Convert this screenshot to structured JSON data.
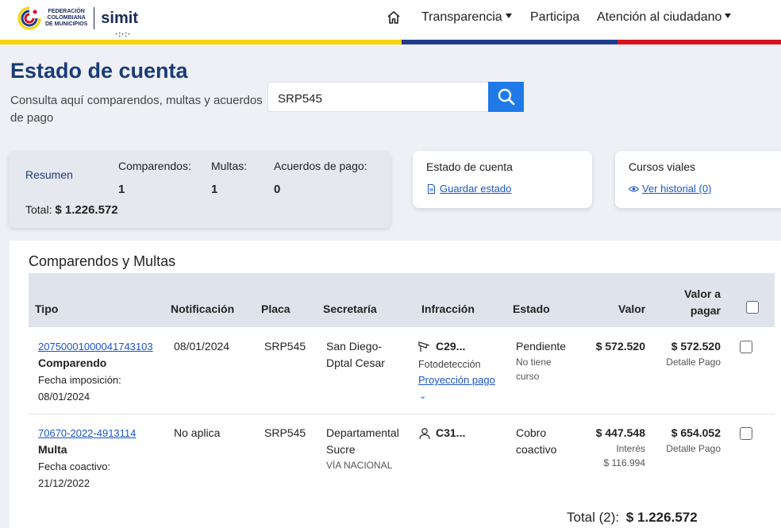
{
  "header": {
    "logo_text": [
      "FEDERACIÓN",
      "COLOMBIANA",
      "DE MUNICIPIOS"
    ],
    "logo_simit": "simit",
    "nav": {
      "home_icon": "home-icon",
      "transparencia": "Transparencia",
      "participa": "Participa",
      "atencion": "Atención al ciudadano"
    },
    "stripe_colors": [
      "#f4d500",
      "#1f3c8c",
      "#d4141c"
    ]
  },
  "page": {
    "title": "Estado de cuenta",
    "subtitle": "Consulta aquí comparendos, multas y acuerdos de pago",
    "search_value": "SRP545"
  },
  "summary": {
    "label": "Resumen",
    "comparendos_label": "Comparendos:",
    "comparendos_value": "1",
    "multas_label": "Multas:",
    "multas_value": "1",
    "acuerdos_label": "Acuerdos de pago:",
    "acuerdos_value": "0",
    "total_label": "Total:",
    "total_value": "$ 1.226.572"
  },
  "estado_card": {
    "title": "Estado de cuenta",
    "link": "Guardar estado"
  },
  "cursos_card": {
    "title": "Cursos viales",
    "link": "Ver historial (0)"
  },
  "table": {
    "title": "Comparendos y Multas",
    "headers": {
      "tipo": "Tipo",
      "notificacion": "Notificación",
      "placa": "Placa",
      "secretaria": "Secretaría",
      "infraccion": "Infracción",
      "estado": "Estado",
      "valor": "Valor",
      "valor_pagar_1": "Valor a",
      "valor_pagar_2": "pagar"
    },
    "rows": [
      {
        "numero": "20750001000041743103",
        "tipo": "Comparendo",
        "fecha_label": "Fecha imposición:",
        "fecha": "08/01/2024",
        "notificacion": "08/01/2024",
        "placa": "SRP545",
        "secretaria_1": "San Diego-",
        "secretaria_2": "Dptal Cesar",
        "infraccion_code": "C29...",
        "infraccion_sub": "Fotodetección",
        "proyeccion": "Proyección pago",
        "estado_1": "Pendiente",
        "estado_sub_1": "No tiene",
        "estado_sub_2": "curso",
        "valor": "$ 572.520",
        "valor_pagar": "$ 572.520",
        "detalle": "Detalle Pago"
      },
      {
        "numero": "70670-2022-4913114",
        "tipo": "Multa",
        "fecha_label": "Fecha coactivo:",
        "fecha": "21/12/2022",
        "notificacion": "No aplica",
        "placa": "SRP545",
        "secretaria_1": "Departamental",
        "secretaria_2": "Sucre",
        "secretaria_sub": "VÍA NACIONAL",
        "infraccion_code": "C31...",
        "estado_1": "Cobro",
        "estado_2": "coactivo",
        "valor": "$ 447.548",
        "interes_label": "Interés",
        "interes": "$ 116.994",
        "valor_pagar": "$ 654.052",
        "detalle": "Detalle Pago"
      }
    ],
    "total_label": "Total (2):",
    "total_value": "$ 1.226.572"
  }
}
